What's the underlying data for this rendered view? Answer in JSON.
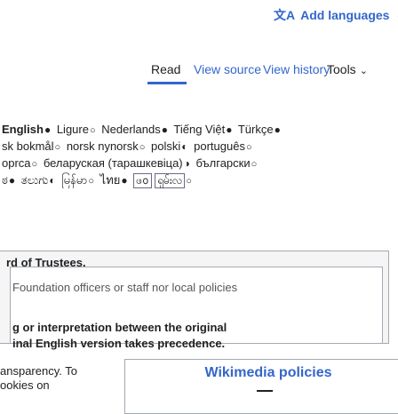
{
  "header": {
    "add_languages": "Add languages",
    "translate_icon": "文A",
    "chevron": "⌄"
  },
  "tabs": {
    "read": "Read",
    "view_source": "View source",
    "view_history": "View history",
    "tools": "Tools",
    "tools_chevron": "⌄"
  },
  "languages": {
    "row1": [
      "English",
      "Ligure",
      "Nederlands",
      "Tiếng Việt",
      "Türkçe"
    ],
    "row2": [
      "sk bokmål",
      "norsk nynorsk",
      "polski",
      "português"
    ],
    "row3": [
      "орrса",
      "беларуская (тарашкевіца)",
      "български"
    ],
    "row4_pre": "ಠ",
    "row4_a": "ತಲುಗು",
    "row4_b": "မြန်မာ",
    "row4_c": "ไทย",
    "row4_boxed": "ဖ⁠ᩅ",
    "row4_d": "ရှမ်းလ"
  },
  "panel": {
    "line1": "rd of Trustees.",
    "line2": "Foundation officers or staff nor local policies",
    "line3": "g or interpretation between the original",
    "line4": "inal English version takes precedence."
  },
  "footer": {
    "line1": "ansparency. To",
    "line2": "ookies on"
  },
  "policies_box": {
    "title": "Wikimedia policies"
  },
  "colors": {
    "link": "#3366cc",
    "text": "#202122",
    "border": "#a2a9b1",
    "panel_bg": "#f5f5f6"
  }
}
